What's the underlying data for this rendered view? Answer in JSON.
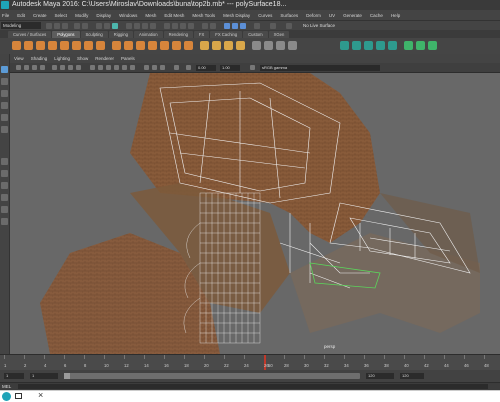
{
  "window": {
    "title": "Autodesk Maya 2016: C:\\Users\\Miroslav\\Downloads\\buna\\top2b.mb* --- polySurface18..."
  },
  "menubar": {
    "items": [
      "File",
      "Edit",
      "Create",
      "Select",
      "Modify",
      "Display",
      "Windows",
      "Mesh",
      "Edit Mesh",
      "Mesh Tools",
      "Mesh Display",
      "Curves",
      "Surfaces",
      "Deform",
      "UV",
      "Generate",
      "Cache",
      "Help"
    ]
  },
  "statusline": {
    "mode": "Modeling",
    "live_surface": "No Live Surface"
  },
  "shelf": {
    "tabs": [
      "Curves / Surfaces",
      "Polygons",
      "Sculpting",
      "Rigging",
      "Animation",
      "Rendering",
      "FX",
      "FX Caching",
      "Custom",
      "XGen"
    ],
    "active_tab": "Polygons"
  },
  "panel": {
    "menus": [
      "View",
      "Shading",
      "Lighting",
      "Show",
      "Renderer",
      "Panels"
    ],
    "near_clip": "0.00",
    "far_clip": "1.00",
    "color_space": "sRGB gamma",
    "camera_label": "persp"
  },
  "timeline": {
    "tick_labels": [
      "1",
      "2",
      "4",
      "6",
      "8",
      "10",
      "12",
      "14",
      "16",
      "18",
      "20",
      "22",
      "24",
      "26",
      "28",
      "30",
      "32",
      "34",
      "36",
      "38",
      "40",
      "42",
      "44",
      "46",
      "48"
    ],
    "current_frame": "50"
  },
  "range": {
    "start": "1",
    "playback_start": "1",
    "playback_end": "120",
    "end": "120"
  },
  "commandline": {
    "label": "MEL"
  },
  "colors": {
    "accent": "#1fa3b8",
    "shelf_orange": "#d7853b",
    "viewport_bg": "#6a6a6a",
    "timeline_marker": "#c0392b"
  }
}
